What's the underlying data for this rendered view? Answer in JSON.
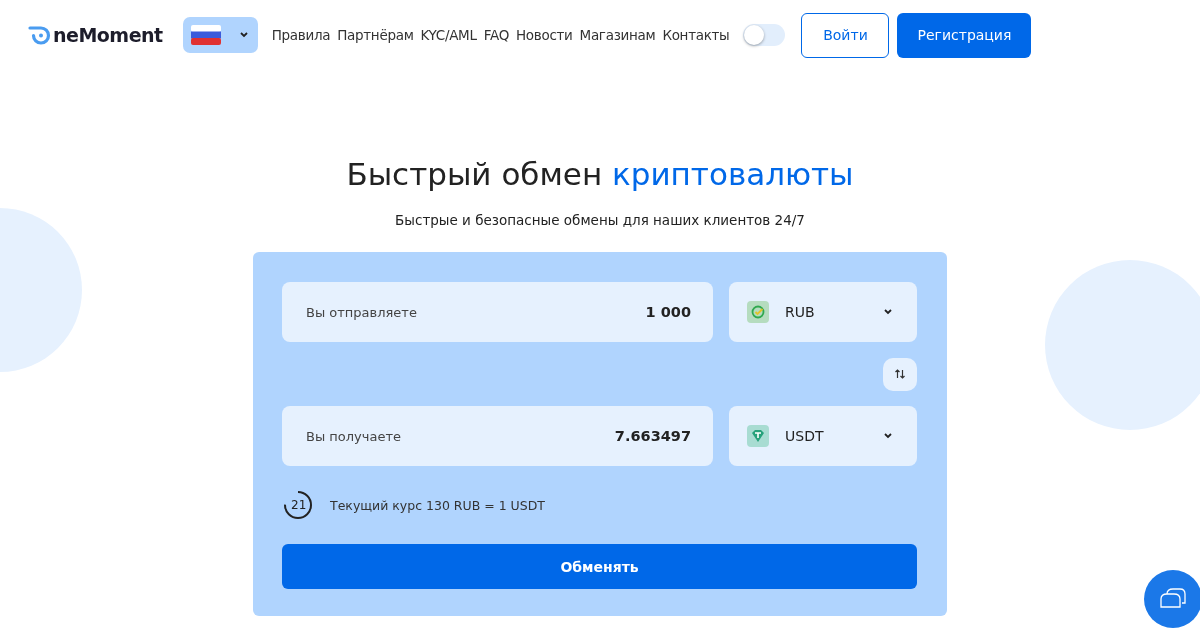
{
  "header": {
    "logo": "neMoment",
    "nav": [
      "Правила",
      "Партнёрам",
      "KYC/AML",
      "FAQ",
      "Новости",
      "Магазинам",
      "Контакты"
    ],
    "theme_toggle": {
      "on": false
    },
    "login": "Войти",
    "register": "Регистрация"
  },
  "hero": {
    "title": "Быстрый обмен **криптовалюты**",
    "subtitle": "Быстрые и безопасные обмены для наших клиентов 24/7"
  },
  "exchange": {
    "send": {
      "label": "Вы отправляете",
      "value": "1 000",
      "currency": "RUB",
      "kind": "rub"
    },
    "receive": {
      "label": "Вы получаете",
      "value": "7.663497",
      "currency": "USDT",
      "kind": "usdt"
    },
    "timer": {
      "count": "21"
    },
    "rate": "Текущий курс 130 RUB = 1 USDT",
    "submit": "Обменять"
  }
}
